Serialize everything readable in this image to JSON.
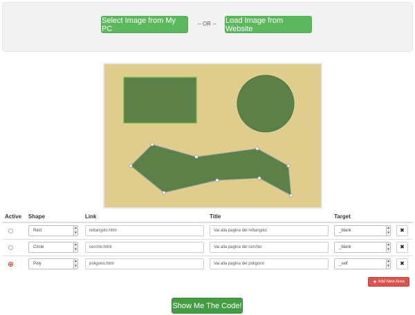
{
  "top": {
    "select_button": "Select Image from My PC",
    "or_text": "-- OR --",
    "load_button": "Load Image from Website"
  },
  "canvas": {
    "background": "#dfcd8e",
    "shape_fill": "#5b8149"
  },
  "table": {
    "headers": [
      "Active",
      "Shape",
      "Link",
      "Title",
      "Target"
    ],
    "rows": [
      {
        "active": false,
        "shape": "Rect",
        "link": "rettangolo.html",
        "title": "Vai alla pagina del rettangolo",
        "target": "_blank"
      },
      {
        "active": false,
        "shape": "Circle",
        "link": "cerchio.html",
        "title": "Vai alla pagina del cerchio",
        "target": "_blank"
      },
      {
        "active": true,
        "shape": "Poly",
        "link": "poligono.html",
        "title": "Vai alla pagina del poligono",
        "target": "_self"
      }
    ],
    "delete_icon": "times-icon"
  },
  "add_area_button": "Add New Area",
  "show_code_button": "Show Me The Code!"
}
